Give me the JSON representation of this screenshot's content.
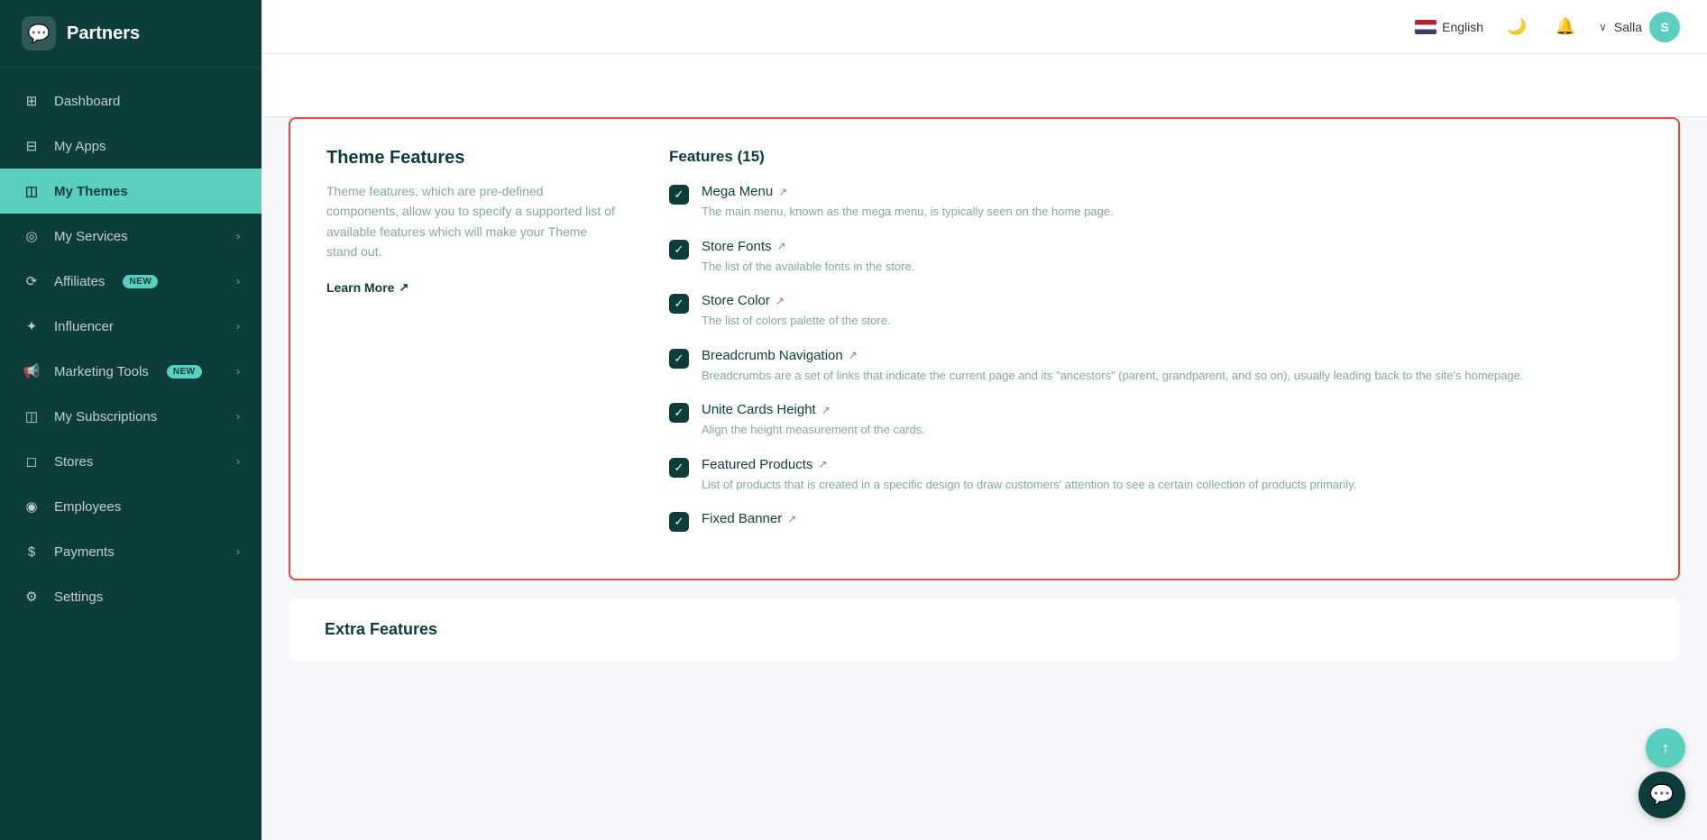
{
  "sidebar": {
    "logo": {
      "text": "Partners",
      "icon": "💬"
    },
    "items": [
      {
        "id": "dashboard",
        "label": "Dashboard",
        "icon": "⊞",
        "active": false,
        "hasChevron": false,
        "badge": null
      },
      {
        "id": "my-apps",
        "label": "My Apps",
        "icon": "⊟",
        "active": false,
        "hasChevron": false,
        "badge": null
      },
      {
        "id": "my-themes",
        "label": "My Themes",
        "icon": "◫",
        "active": true,
        "hasChevron": false,
        "badge": null
      },
      {
        "id": "my-services",
        "label": "My Services",
        "icon": "◎",
        "active": false,
        "hasChevron": true,
        "badge": null
      },
      {
        "id": "affiliates",
        "label": "Affiliates",
        "icon": "⟳",
        "active": false,
        "hasChevron": true,
        "badge": "NEW"
      },
      {
        "id": "influencer",
        "label": "Influencer",
        "icon": "✦",
        "active": false,
        "hasChevron": true,
        "badge": null
      },
      {
        "id": "marketing-tools",
        "label": "Marketing Tools",
        "icon": "📢",
        "active": false,
        "hasChevron": true,
        "badge": "NEW"
      },
      {
        "id": "my-subscriptions",
        "label": "My Subscriptions",
        "icon": "◫",
        "active": false,
        "hasChevron": true,
        "badge": null
      },
      {
        "id": "stores",
        "label": "Stores",
        "icon": "◻",
        "active": false,
        "hasChevron": true,
        "badge": null
      },
      {
        "id": "employees",
        "label": "Employees",
        "icon": "◉",
        "active": false,
        "hasChevron": false,
        "badge": null
      },
      {
        "id": "payments",
        "label": "Payments",
        "icon": "$",
        "active": false,
        "hasChevron": true,
        "badge": null
      },
      {
        "id": "settings",
        "label": "Settings",
        "icon": "⚙",
        "active": false,
        "hasChevron": false,
        "badge": null
      }
    ]
  },
  "topbar": {
    "language": "English",
    "username": "Salla"
  },
  "main": {
    "theme_features": {
      "section_title": "Theme Features",
      "description": "Theme features, which are pre-defined components, allow you to specify a supported list of available features which will make your Theme stand out.",
      "learn_more": "Learn More",
      "features_header": "Features (15)",
      "features": [
        {
          "title": "Mega Menu",
          "description": "The main menu, known as the mega menu, is typically seen on the home page."
        },
        {
          "title": "Store Fonts",
          "description": "The list of the available fonts in the store."
        },
        {
          "title": "Store Color",
          "description": "The list of colors palette of the store."
        },
        {
          "title": "Breadcrumb Navigation",
          "description": "Breadcrumbs are a set of links that indicate the current page and its \"ancestors\" (parent, grandparent, and so on), usually leading back to the site's homepage."
        },
        {
          "title": "Unite Cards Height",
          "description": "Align the height measurement of the cards."
        },
        {
          "title": "Featured Products",
          "description": "List of products that is created in a specific design to draw customers' attention to see a certain collection of products primarily."
        },
        {
          "title": "Fixed Banner",
          "description": ""
        }
      ]
    },
    "extra_features": {
      "section_title": "Extra Features"
    }
  }
}
